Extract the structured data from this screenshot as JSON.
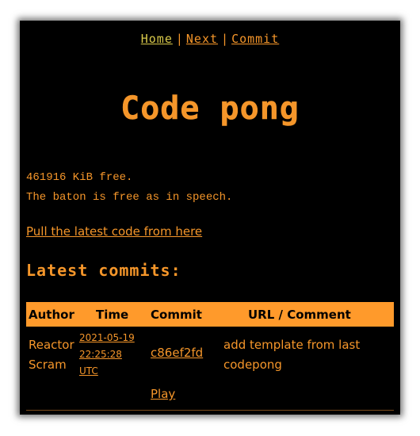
{
  "nav": {
    "home": "Home",
    "sep1": "|",
    "next": "Next",
    "sep2": "|",
    "commit": "Commit"
  },
  "title": "Code pong",
  "status": {
    "free_space": "461916 KiB free.",
    "baton": "The baton is free as in speech."
  },
  "pull_link": "Pull the latest code from here",
  "latest_heading": "Latest commits:",
  "table": {
    "headers": [
      "Author",
      "Time",
      "Commit",
      "URL / Comment"
    ],
    "rows": [
      {
        "author_line1": "Reactor",
        "author_line2": "Scram",
        "time_line1": "2021-05-19",
        "time_line2": "22:25:28",
        "time_line3": "UTC",
        "commit": "c86ef2fd",
        "comment_line1": "add template from last",
        "comment_line2": "codepong",
        "action": "Play"
      }
    ]
  },
  "colors": {
    "background": "#000000",
    "accent": "#f5962a",
    "header_bg": "#ff9a2b",
    "home_link": "#d8c84a"
  }
}
